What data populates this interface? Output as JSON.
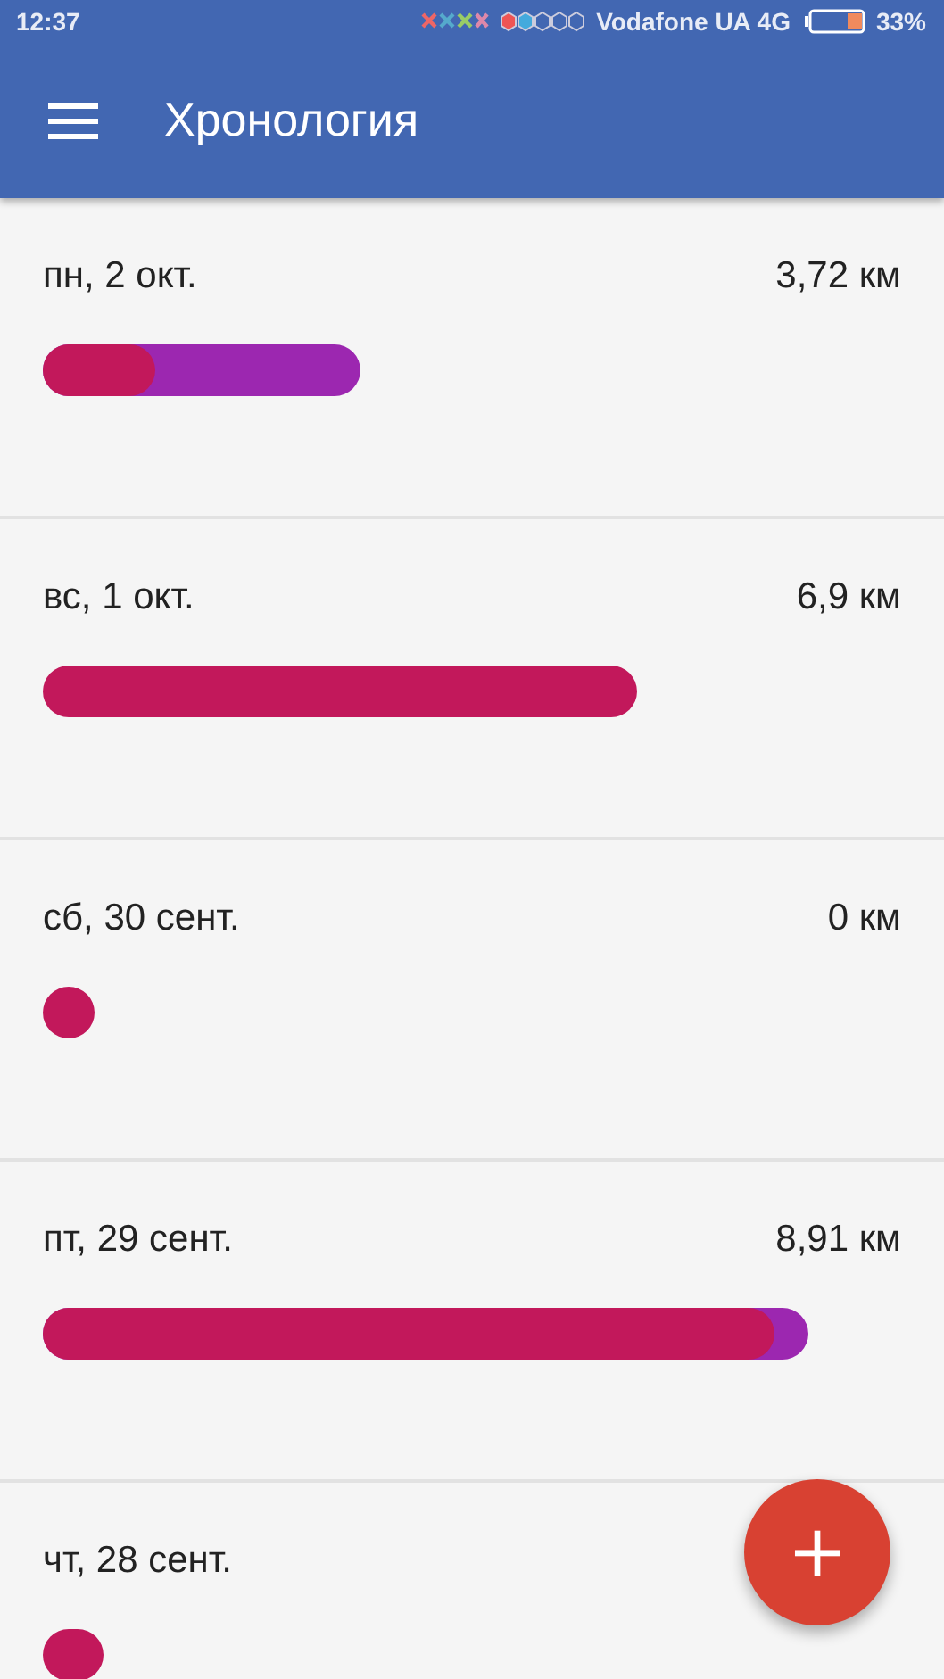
{
  "status_bar": {
    "time": "12:37",
    "carrier": "Vodafone UA 4G",
    "battery": "33%"
  },
  "toolbar": {
    "title": "Хронология"
  },
  "days": [
    {
      "date": "пн, 2 окт.",
      "distance": "3,72 км",
      "segments": [
        {
          "color": "#9c27b0"
        },
        {
          "color": "#c2185b"
        }
      ]
    },
    {
      "date": "вс, 1 окт.",
      "distance": "6,9 км",
      "segments": [
        {
          "color": "#c2185b"
        }
      ]
    },
    {
      "date": "сб, 30 сент.",
      "distance": "0 км",
      "segments": [
        {
          "color": "#c2185b"
        }
      ]
    },
    {
      "date": "пт, 29 сент.",
      "distance": "8,91 км",
      "segments": [
        {
          "color": "#9c27b0"
        },
        {
          "color": "#c2185b"
        }
      ]
    },
    {
      "date": "чт, 28 сент.",
      "segments": [
        {
          "color": "#c2185b"
        }
      ]
    }
  ],
  "fab": {
    "label": "+"
  }
}
